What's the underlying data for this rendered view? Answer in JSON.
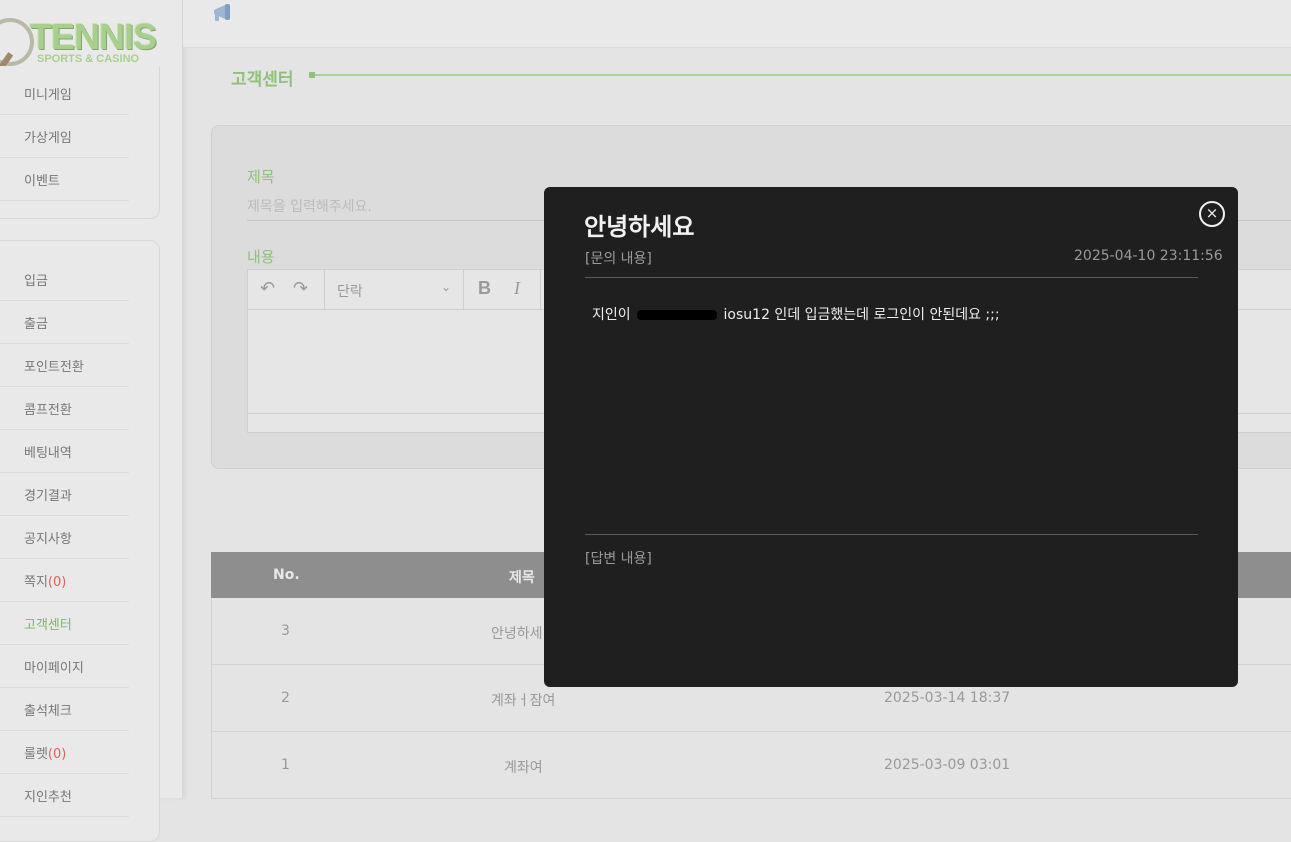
{
  "logo": {
    "title": "TENNIS",
    "subtitle": "SPORTS & CASINO"
  },
  "sidebar": {
    "group1": [
      {
        "label": "미니게임",
        "icon": "target-icon"
      },
      {
        "label": "가상게임",
        "icon": "gamepad-icon"
      },
      {
        "label": "이벤트",
        "icon": "gift-icon"
      }
    ],
    "group2": [
      {
        "label": "입금",
        "icon": "deposit-icon"
      },
      {
        "label": "출금",
        "icon": "withdraw-icon"
      },
      {
        "label": "포인트전환",
        "icon": "point-icon"
      },
      {
        "label": "콤프전환",
        "icon": "comp-icon"
      },
      {
        "label": "베팅내역",
        "icon": "bet-history-icon"
      },
      {
        "label": "경기결과",
        "icon": "trophy-icon"
      },
      {
        "label": "공지사항",
        "icon": "bell-icon"
      },
      {
        "label": "쪽지",
        "count": "(0)",
        "icon": "message-icon"
      },
      {
        "label": "고객센터",
        "icon": "support-icon",
        "active": true
      },
      {
        "label": "마이페이지",
        "icon": "user-icon"
      },
      {
        "label": "출석체크",
        "icon": "calendar-icon"
      },
      {
        "label": "룰렛",
        "count": "(0)",
        "icon": "roulette-icon"
      },
      {
        "label": "지인추천",
        "icon": "refer-icon"
      }
    ]
  },
  "page": {
    "title": "고객센터"
  },
  "form": {
    "title_label": "제목",
    "title_placeholder": "제목을 입력해주세요.",
    "content_label": "내용",
    "paragraph_select": "단락"
  },
  "table": {
    "headers": [
      "No.",
      "제목"
    ],
    "rows": [
      {
        "no": "3",
        "title": "안녕하세",
        "date": ""
      },
      {
        "no": "2",
        "title": "계좌ㅓ잠여",
        "date": "2025-03-14 18:37"
      },
      {
        "no": "1",
        "title": "계좌여",
        "date": "2025-03-09 03:01"
      }
    ]
  },
  "modal": {
    "title": "안녕하세요",
    "inquiry_label": "[문의 내용]",
    "date": "2025-04-10 23:11:56",
    "body_prefix": "지인이",
    "body_suffix": "iosu12 인데 입금했는데 로그인이 안된데요 ;;;",
    "answer_label": "[답변 내용]",
    "close_symbol": "×"
  },
  "colors": {
    "accent": "#8fc178",
    "modal_bg": "#1f1f1f",
    "table_head": "#8e8e8e",
    "alert": "#e35d5d"
  }
}
